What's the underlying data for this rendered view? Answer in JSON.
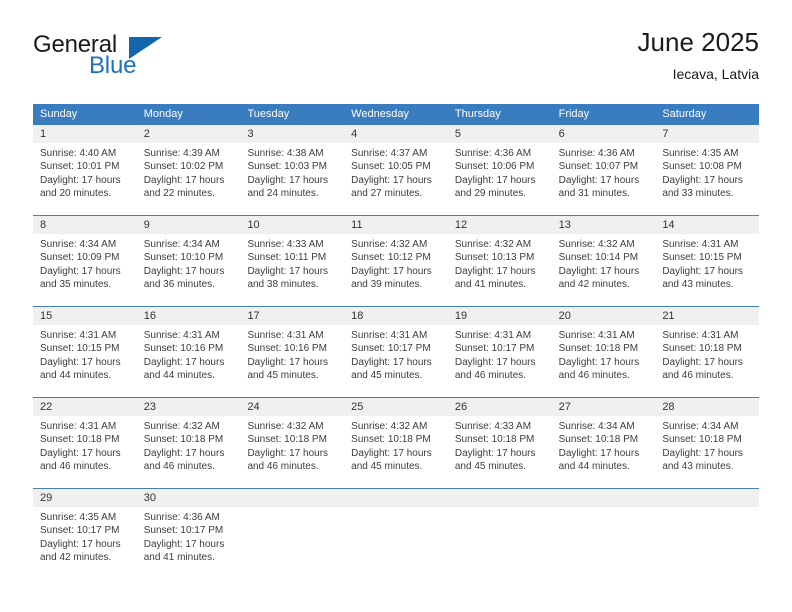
{
  "brand": {
    "logo_line1": "General",
    "logo_line2": "Blue",
    "logo_triangle": "blue-triangle-icon",
    "color_black": "#1b1b1b",
    "color_blue": "#1c72bd"
  },
  "header": {
    "title": "June 2025",
    "subtitle": "Iecava, Latvia"
  },
  "theme": {
    "header_bg": "#3a7cc0",
    "header_text": "#ffffff",
    "daynum_bg": "#f0f0f0",
    "row_border": "#4a7fb5",
    "body_text": "#3d3d3d"
  },
  "weekdays": [
    "Sunday",
    "Monday",
    "Tuesday",
    "Wednesday",
    "Thursday",
    "Friday",
    "Saturday"
  ],
  "weeks": [
    [
      {
        "day": "1",
        "sunrise": "Sunrise: 4:40 AM",
        "sunset": "Sunset: 10:01 PM",
        "daylight1": "Daylight: 17 hours",
        "daylight2": "and 20 minutes."
      },
      {
        "day": "2",
        "sunrise": "Sunrise: 4:39 AM",
        "sunset": "Sunset: 10:02 PM",
        "daylight1": "Daylight: 17 hours",
        "daylight2": "and 22 minutes."
      },
      {
        "day": "3",
        "sunrise": "Sunrise: 4:38 AM",
        "sunset": "Sunset: 10:03 PM",
        "daylight1": "Daylight: 17 hours",
        "daylight2": "and 24 minutes."
      },
      {
        "day": "4",
        "sunrise": "Sunrise: 4:37 AM",
        "sunset": "Sunset: 10:05 PM",
        "daylight1": "Daylight: 17 hours",
        "daylight2": "and 27 minutes."
      },
      {
        "day": "5",
        "sunrise": "Sunrise: 4:36 AM",
        "sunset": "Sunset: 10:06 PM",
        "daylight1": "Daylight: 17 hours",
        "daylight2": "and 29 minutes."
      },
      {
        "day": "6",
        "sunrise": "Sunrise: 4:36 AM",
        "sunset": "Sunset: 10:07 PM",
        "daylight1": "Daylight: 17 hours",
        "daylight2": "and 31 minutes."
      },
      {
        "day": "7",
        "sunrise": "Sunrise: 4:35 AM",
        "sunset": "Sunset: 10:08 PM",
        "daylight1": "Daylight: 17 hours",
        "daylight2": "and 33 minutes."
      }
    ],
    [
      {
        "day": "8",
        "sunrise": "Sunrise: 4:34 AM",
        "sunset": "Sunset: 10:09 PM",
        "daylight1": "Daylight: 17 hours",
        "daylight2": "and 35 minutes."
      },
      {
        "day": "9",
        "sunrise": "Sunrise: 4:34 AM",
        "sunset": "Sunset: 10:10 PM",
        "daylight1": "Daylight: 17 hours",
        "daylight2": "and 36 minutes."
      },
      {
        "day": "10",
        "sunrise": "Sunrise: 4:33 AM",
        "sunset": "Sunset: 10:11 PM",
        "daylight1": "Daylight: 17 hours",
        "daylight2": "and 38 minutes."
      },
      {
        "day": "11",
        "sunrise": "Sunrise: 4:32 AM",
        "sunset": "Sunset: 10:12 PM",
        "daylight1": "Daylight: 17 hours",
        "daylight2": "and 39 minutes."
      },
      {
        "day": "12",
        "sunrise": "Sunrise: 4:32 AM",
        "sunset": "Sunset: 10:13 PM",
        "daylight1": "Daylight: 17 hours",
        "daylight2": "and 41 minutes."
      },
      {
        "day": "13",
        "sunrise": "Sunrise: 4:32 AM",
        "sunset": "Sunset: 10:14 PM",
        "daylight1": "Daylight: 17 hours",
        "daylight2": "and 42 minutes."
      },
      {
        "day": "14",
        "sunrise": "Sunrise: 4:31 AM",
        "sunset": "Sunset: 10:15 PM",
        "daylight1": "Daylight: 17 hours",
        "daylight2": "and 43 minutes."
      }
    ],
    [
      {
        "day": "15",
        "sunrise": "Sunrise: 4:31 AM",
        "sunset": "Sunset: 10:15 PM",
        "daylight1": "Daylight: 17 hours",
        "daylight2": "and 44 minutes."
      },
      {
        "day": "16",
        "sunrise": "Sunrise: 4:31 AM",
        "sunset": "Sunset: 10:16 PM",
        "daylight1": "Daylight: 17 hours",
        "daylight2": "and 44 minutes."
      },
      {
        "day": "17",
        "sunrise": "Sunrise: 4:31 AM",
        "sunset": "Sunset: 10:16 PM",
        "daylight1": "Daylight: 17 hours",
        "daylight2": "and 45 minutes."
      },
      {
        "day": "18",
        "sunrise": "Sunrise: 4:31 AM",
        "sunset": "Sunset: 10:17 PM",
        "daylight1": "Daylight: 17 hours",
        "daylight2": "and 45 minutes."
      },
      {
        "day": "19",
        "sunrise": "Sunrise: 4:31 AM",
        "sunset": "Sunset: 10:17 PM",
        "daylight1": "Daylight: 17 hours",
        "daylight2": "and 46 minutes."
      },
      {
        "day": "20",
        "sunrise": "Sunrise: 4:31 AM",
        "sunset": "Sunset: 10:18 PM",
        "daylight1": "Daylight: 17 hours",
        "daylight2": "and 46 minutes."
      },
      {
        "day": "21",
        "sunrise": "Sunrise: 4:31 AM",
        "sunset": "Sunset: 10:18 PM",
        "daylight1": "Daylight: 17 hours",
        "daylight2": "and 46 minutes."
      }
    ],
    [
      {
        "day": "22",
        "sunrise": "Sunrise: 4:31 AM",
        "sunset": "Sunset: 10:18 PM",
        "daylight1": "Daylight: 17 hours",
        "daylight2": "and 46 minutes."
      },
      {
        "day": "23",
        "sunrise": "Sunrise: 4:32 AM",
        "sunset": "Sunset: 10:18 PM",
        "daylight1": "Daylight: 17 hours",
        "daylight2": "and 46 minutes."
      },
      {
        "day": "24",
        "sunrise": "Sunrise: 4:32 AM",
        "sunset": "Sunset: 10:18 PM",
        "daylight1": "Daylight: 17 hours",
        "daylight2": "and 46 minutes."
      },
      {
        "day": "25",
        "sunrise": "Sunrise: 4:32 AM",
        "sunset": "Sunset: 10:18 PM",
        "daylight1": "Daylight: 17 hours",
        "daylight2": "and 45 minutes."
      },
      {
        "day": "26",
        "sunrise": "Sunrise: 4:33 AM",
        "sunset": "Sunset: 10:18 PM",
        "daylight1": "Daylight: 17 hours",
        "daylight2": "and 45 minutes."
      },
      {
        "day": "27",
        "sunrise": "Sunrise: 4:34 AM",
        "sunset": "Sunset: 10:18 PM",
        "daylight1": "Daylight: 17 hours",
        "daylight2": "and 44 minutes."
      },
      {
        "day": "28",
        "sunrise": "Sunrise: 4:34 AM",
        "sunset": "Sunset: 10:18 PM",
        "daylight1": "Daylight: 17 hours",
        "daylight2": "and 43 minutes."
      }
    ],
    [
      {
        "day": "29",
        "sunrise": "Sunrise: 4:35 AM",
        "sunset": "Sunset: 10:17 PM",
        "daylight1": "Daylight: 17 hours",
        "daylight2": "and 42 minutes."
      },
      {
        "day": "30",
        "sunrise": "Sunrise: 4:36 AM",
        "sunset": "Sunset: 10:17 PM",
        "daylight1": "Daylight: 17 hours",
        "daylight2": "and 41 minutes."
      },
      {
        "day": "",
        "sunrise": "",
        "sunset": "",
        "daylight1": "",
        "daylight2": ""
      },
      {
        "day": "",
        "sunrise": "",
        "sunset": "",
        "daylight1": "",
        "daylight2": ""
      },
      {
        "day": "",
        "sunrise": "",
        "sunset": "",
        "daylight1": "",
        "daylight2": ""
      },
      {
        "day": "",
        "sunrise": "",
        "sunset": "",
        "daylight1": "",
        "daylight2": ""
      },
      {
        "day": "",
        "sunrise": "",
        "sunset": "",
        "daylight1": "",
        "daylight2": ""
      }
    ]
  ]
}
